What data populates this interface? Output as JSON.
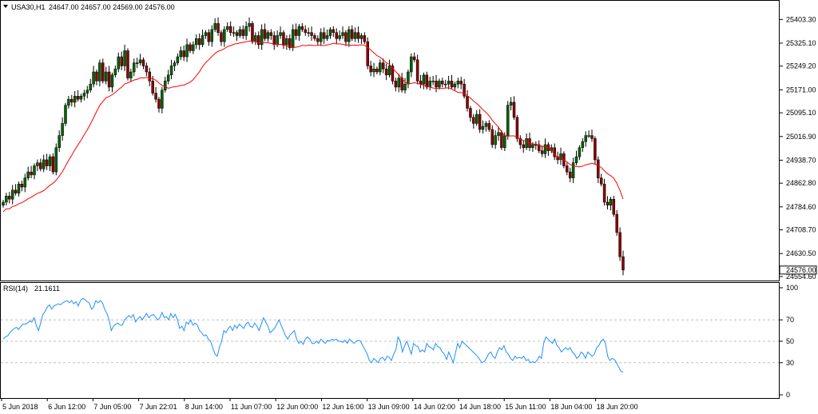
{
  "header": {
    "symbol": "USA30,H1",
    "ohlc": "24647.00 24657.00 24569.00 24576.00"
  },
  "rsi_header": {
    "name": "RSI(14)",
    "value": "21.1611"
  },
  "price_axis": [
    "25403.30",
    "25325.10",
    "25249.20",
    "25171.00",
    "25095.10",
    "25016.90",
    "24938.70",
    "24862.80",
    "24784.60",
    "24708.70",
    "24630.50",
    "24554.60"
  ],
  "current_price": "24576.00",
  "rsi_axis": [
    "100",
    "70",
    "50",
    "30",
    "0"
  ],
  "time_axis": [
    "5 Jun 2018",
    "6 Jun 12:00",
    "7 Jun 05:00",
    "7 Jun 22:01",
    "8 Jun 14:00",
    "11 Jun 07:00",
    "12 Jun 00:00",
    "12 Jun 16:00",
    "13 Jun 09:00",
    "14 Jun 02:00",
    "14 Jun 18:00",
    "15 Jun 11:00",
    "18 Jun 04:00",
    "18 Jun 20:00"
  ],
  "colors": {
    "up": "#006400",
    "down": "#8b0000",
    "ma": "#ff0000",
    "rsi": "#1e90ff",
    "grid": "#c0c0c0",
    "frame": "#000000"
  },
  "chart_data": [
    {
      "type": "candlestick",
      "title": "USA30,H1",
      "ylim": [
        24554.6,
        25420
      ],
      "overlay": {
        "name": "",
        "type": "moving-average"
      },
      "close": [
        24800,
        24820,
        24810,
        24840,
        24830,
        24860,
        24850,
        24880,
        24900,
        24890,
        24920,
        24930,
        24910,
        24940,
        24920,
        24950,
        24900,
        24980,
        25020,
        25060,
        25120,
        25140,
        25130,
        25150,
        25140,
        25150,
        25160,
        25170,
        25190,
        25230,
        25200,
        25260,
        25200,
        25230,
        25180,
        25220,
        25240,
        25280,
        25250,
        25300,
        25210,
        25230,
        25260,
        25260,
        25270,
        25250,
        25230,
        25200,
        25160,
        25140,
        25110,
        25170,
        25200,
        25220,
        25250,
        25260,
        25280,
        25300,
        25280,
        25320,
        25300,
        25320,
        25340,
        25320,
        25350,
        25360,
        25330,
        25370,
        25390,
        25360,
        25330,
        25370,
        25380,
        25360,
        25360,
        25350,
        25370,
        25350,
        25380,
        25390,
        25330,
        25350,
        25320,
        25370,
        25340,
        25360,
        25350,
        25320,
        25350,
        25360,
        25320,
        25340,
        25310,
        25370,
        25350,
        25380,
        25370,
        25360,
        25360,
        25350,
        25340,
        25330,
        25360,
        25340,
        25350,
        25370,
        25360,
        25340,
        25350,
        25360,
        25330,
        25370,
        25340,
        25360,
        25340,
        25350,
        25330,
        25250,
        25230,
        25240,
        25230,
        25260,
        25240,
        25220,
        25250,
        25200,
        25180,
        25210,
        25170,
        25190,
        25230,
        25280,
        25270,
        25200,
        25190,
        25220,
        25180,
        25200,
        25200,
        25180,
        25200,
        25190,
        25190,
        25200,
        25180,
        25190,
        25200,
        25190,
        25150,
        25110,
        25080,
        25060,
        25090,
        25040,
        25050,
        25060,
        25040,
        24990,
        25020,
        25030,
        24980,
        25020,
        25120,
        25130,
        25080,
        25010,
        24990,
        24980,
        25010,
        24980,
        24990,
        24990,
        24970,
        24960,
        24990,
        24970,
        24980,
        24950,
        24940,
        24960,
        24920,
        24900,
        24880,
        24930,
        24950,
        24980,
        25000,
        25020,
        25020,
        25010,
        24940,
        24880,
        24860,
        24800,
        24790,
        24810,
        24760,
        24700,
        24620,
        24576
      ]
    },
    {
      "type": "line",
      "title": "RSI(14)",
      "ylim": [
        0,
        100
      ],
      "reference_lines": [
        70,
        50,
        30
      ],
      "values": [
        52,
        54,
        55,
        58,
        60,
        62,
        63,
        61,
        64,
        66,
        66,
        67,
        69,
        68,
        72,
        65,
        60,
        67,
        75,
        78,
        82,
        84,
        80,
        83,
        84,
        85,
        84,
        86,
        87,
        88,
        86,
        88,
        85,
        87,
        83,
        88,
        90,
        89,
        87,
        86,
        80,
        82,
        88,
        86,
        88,
        86,
        80,
        76,
        70,
        60,
        64,
        66,
        67,
        65,
        65,
        70,
        72,
        74,
        72,
        75,
        68,
        71,
        73,
        70,
        73,
        76,
        72,
        74,
        75,
        73,
        70,
        72,
        77,
        72,
        73,
        70,
        76,
        72,
        75,
        70,
        62,
        64,
        60,
        68,
        66,
        70,
        65,
        67,
        65,
        60,
        58,
        55,
        56,
        52,
        50,
        44,
        38,
        36,
        44,
        50,
        60,
        58,
        62,
        64,
        60,
        65,
        62,
        66,
        64,
        62,
        66,
        68,
        64,
        63,
        67,
        64,
        60,
        66,
        72,
        68,
        64,
        58,
        60,
        62,
        66,
        70,
        65,
        60,
        55,
        52,
        56,
        58,
        60,
        52,
        48,
        50,
        47,
        52,
        54,
        52,
        48,
        48,
        50,
        48,
        52,
        50,
        48,
        51,
        50,
        52,
        51,
        52,
        50,
        50,
        49,
        51,
        48,
        52,
        50,
        48,
        50,
        51,
        50,
        46,
        42,
        38,
        32,
        30,
        34,
        32,
        30,
        34,
        35,
        32,
        36,
        35,
        32,
        38,
        42,
        54,
        50,
        40,
        46,
        50,
        44,
        38,
        48,
        46,
        45,
        40,
        42,
        40,
        48,
        45,
        44,
        42,
        48,
        45,
        44,
        40,
        38,
        33,
        40,
        35,
        30,
        39,
        48,
        44,
        50,
        48,
        46,
        44,
        42,
        40,
        38,
        36,
        33,
        30,
        31,
        34,
        38,
        40,
        36,
        34,
        40,
        44,
        42,
        46,
        40,
        38,
        34,
        32,
        36,
        34,
        35,
        34,
        36,
        32,
        33,
        30,
        31,
        30,
        32,
        36,
        34,
        48,
        54,
        52,
        50,
        48,
        52,
        46,
        44,
        40,
        42,
        44,
        42,
        44,
        40,
        38,
        34,
        36,
        40,
        38,
        34,
        40,
        38,
        36,
        38,
        44,
        46,
        50,
        52,
        48,
        36,
        32,
        34,
        33,
        30,
        26,
        22,
        21.16
      ]
    }
  ]
}
